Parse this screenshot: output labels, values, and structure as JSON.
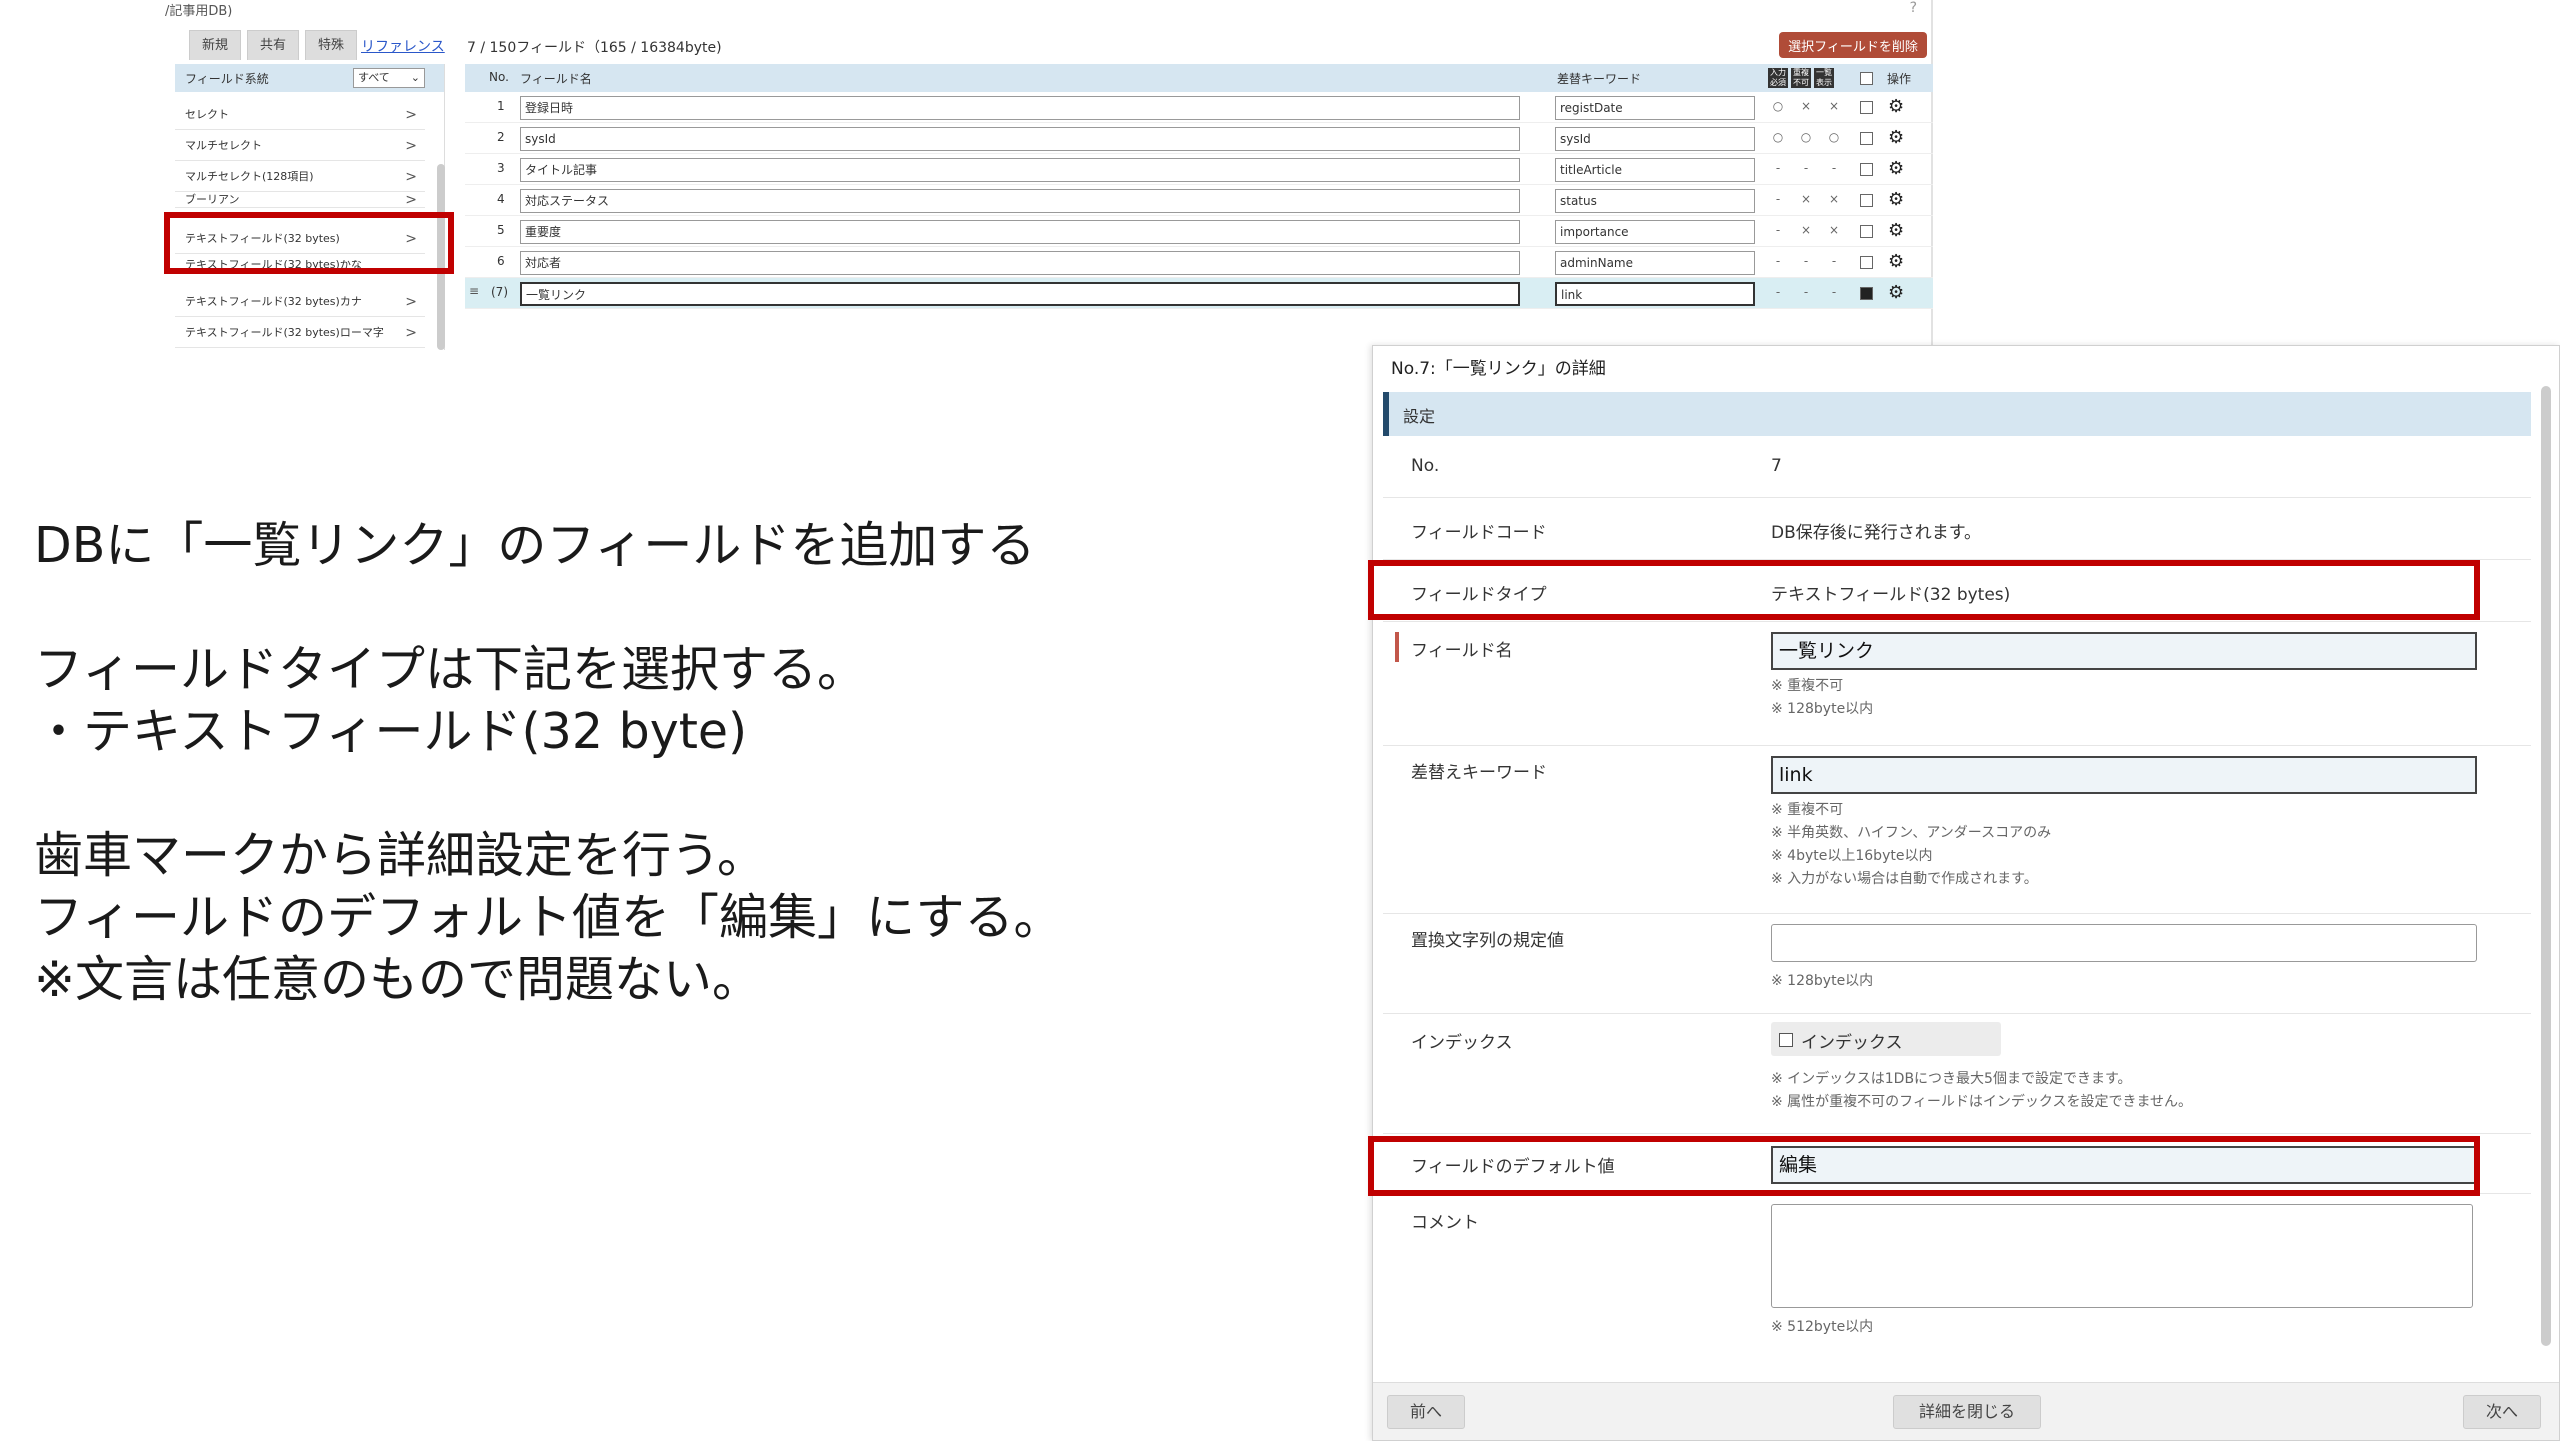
{
  "top_panel": {
    "title": "/記事用DB)",
    "help": "?",
    "tabs": [
      "新規",
      "共有",
      "特殊"
    ],
    "reference_tab": "リファレンス",
    "field_count": "7 / 150フィールド（165 / 16384byte)",
    "delete_button": "選択フィールドを削除",
    "category_header": "フィールド系統",
    "category_filter": "すべて",
    "categories": [
      "セレクト",
      "マルチセレクト",
      "マルチセレクト(128項目)",
      "ブーリアン",
      "テキストフィールド(32 bytes)",
      "テキストフィールド(32 bytes)かな",
      "テキストフィールド(32 bytes)カナ",
      "テキストフィールド(32 bytes)ローマ字"
    ],
    "grid_headers": {
      "no": "No.",
      "name": "フィールド名",
      "keyword": "差替キーワード",
      "operation": "操作",
      "icon1": "入力必須",
      "icon2": "重複不可",
      "icon3": "一覧表示"
    },
    "rows": [
      {
        "no": "1",
        "name": "登録日時",
        "key": "registDate",
        "a1": "○",
        "a2": "×",
        "a3": "×"
      },
      {
        "no": "2",
        "name": "sysId",
        "key": "sysId",
        "a1": "○",
        "a2": "○",
        "a3": "○"
      },
      {
        "no": "3",
        "name": "タイトル記事",
        "key": "titleArticle",
        "a1": "-",
        "a2": "-",
        "a3": "-"
      },
      {
        "no": "4",
        "name": "対応ステータス",
        "key": "status",
        "a1": "-",
        "a2": "×",
        "a3": "×"
      },
      {
        "no": "5",
        "name": "重要度",
        "key": "importance",
        "a1": "-",
        "a2": "×",
        "a3": "×"
      },
      {
        "no": "6",
        "name": "対応者",
        "key": "adminName",
        "a1": "-",
        "a2": "-",
        "a3": "-"
      },
      {
        "no": "(7)",
        "name": "一覧リンク",
        "key": "link",
        "a1": "-",
        "a2": "-",
        "a3": "-"
      }
    ],
    "drag_handle": "≡"
  },
  "instructions": {
    "line1": "DBに「一覧リンク」のフィールドを追加する",
    "line2": "フィールドタイプは下記を選択する。",
    "line3": "・テキストフィールド(32 byte)",
    "line4": "歯車マークから詳細設定を行う。",
    "line5": "フィールドのデフォルト値を「編集」にする。",
    "line6": "※文言は任意のもので問題ない。"
  },
  "detail": {
    "title": "No.7:「一覧リンク」の詳細",
    "section": "設定",
    "no_label": "No.",
    "no_value": "7",
    "code_label": "フィールドコード",
    "code_value": "DB保存後に発行されます。",
    "type_label": "フィールドタイプ",
    "type_value": "テキストフィールド(32 bytes)",
    "name_label": "フィールド名",
    "name_value": "一覧リンク",
    "name_note1": "※ 重複不可",
    "name_note2": "※ 128byte以内",
    "keyword_label": "差替えキーワード",
    "keyword_value": "link",
    "keyword_note1": "※ 重複不可",
    "keyword_note2": "※ 半角英数、ハイフン、アンダースコアのみ",
    "keyword_note3": "※ 4byte以上16byte以内",
    "keyword_note4": "※ 入力がない場合は自動で作成されます。",
    "default_str_label": "置換文字列の規定値",
    "default_str_note": "※ 128byte以内",
    "index_label": "インデックス",
    "index_checkbox": "インデックス",
    "index_note1": "※ インデックスは1DBにつき最大5個まで設定できます。",
    "index_note2": "※ 属性が重複不可のフィールドはインデックスを設定できません。",
    "default_label": "フィールドのデフォルト値",
    "default_value": "編集",
    "comment_label": "コメント",
    "comment_note": "※ 512byte以内",
    "prev_button": "前へ",
    "close_button": "詳細を閉じる",
    "next_button": "次へ"
  },
  "colors": {
    "highlight": "#c00000",
    "header_bg": "#d6e6f1",
    "delete_button": "#b04c38"
  }
}
